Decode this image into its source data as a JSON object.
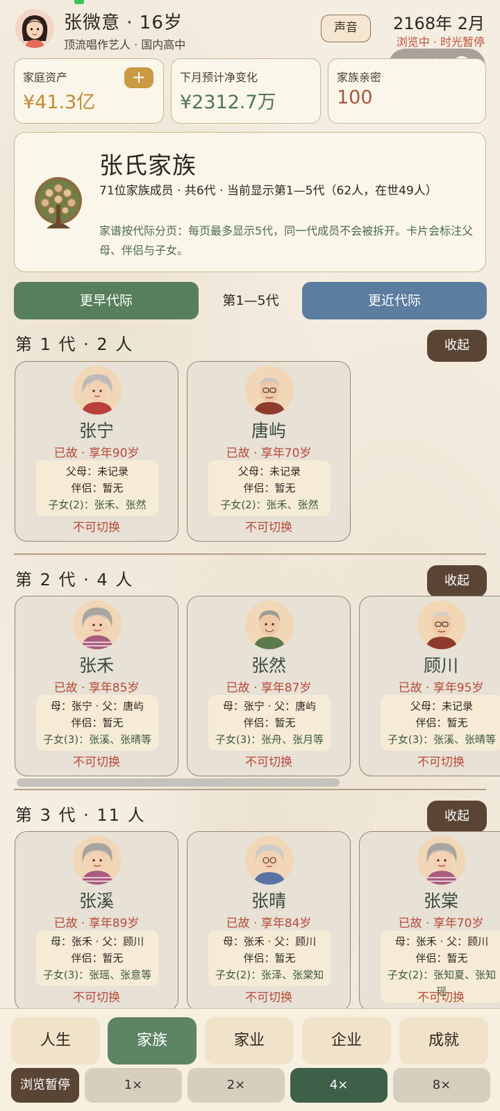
{
  "header": {
    "name_age": "张微意 · 16岁",
    "title": "顶流唱作艺人 · 国内高中",
    "sound_label": "声音",
    "date": "2168年 2月",
    "status": "浏览中 · 时光暂停",
    "capsule_dots": "•••"
  },
  "stats": [
    {
      "label": "家庭资产",
      "value": "¥41.3亿",
      "action": "+"
    },
    {
      "label": "下月预计净变化",
      "value": "¥2312.7万"
    },
    {
      "label": "家族亲密",
      "value": "100"
    }
  ],
  "family": {
    "title": "张氏家族",
    "summary": "71位家族成员 · 共6代 · 当前显示第1—5代（62人，在世49人）",
    "description": "家谱按代际分页：每页最多显示5代，同一代成员不会被拆开。卡片会标注父母、伴侣与子女。"
  },
  "nav": {
    "earlier": "更早代际",
    "range": "第1—5代",
    "later": "更近代际"
  },
  "generations": [
    {
      "title": "第 1 代 · 2 人",
      "collapse": "收起",
      "members": [
        {
          "name": "张宁",
          "status": "已故 · 享年90岁",
          "parents": "父母：未记录",
          "partner": "伴侣：暂无",
          "children": "子女(2)：张禾、张然",
          "switch": "不可切换"
        },
        {
          "name": "唐屿",
          "status": "已故 · 享年70岁",
          "parents": "父母：未记录",
          "partner": "伴侣：暂无",
          "children": "子女(2)：张禾、张然",
          "switch": "不可切换"
        }
      ]
    },
    {
      "title": "第 2 代 · 4 人",
      "collapse": "收起",
      "members": [
        {
          "name": "张禾",
          "status": "已故 · 享年85岁",
          "parents": "母：张宁 · 父：唐屿",
          "partner": "伴侣：暂无",
          "children": "子女(3)：张溪、张晴等",
          "switch": "不可切换"
        },
        {
          "name": "张然",
          "status": "已故 · 享年87岁",
          "parents": "母：张宁 · 父：唐屿",
          "partner": "伴侣：暂无",
          "children": "子女(3)：张舟、张月等",
          "switch": "不可切换"
        },
        {
          "name": "顾川",
          "status": "已故 · 享年95岁",
          "parents": "父母：未记录",
          "partner": "伴侣：暂无",
          "children": "子女(3)：张溪、张晴等",
          "switch": "不可切换"
        }
      ]
    },
    {
      "title": "第 3 代 · 11 人",
      "collapse": "收起",
      "members": [
        {
          "name": "张溪",
          "status": "已故 · 享年89岁",
          "parents": "母：张禾 · 父：顾川",
          "partner": "伴侣：暂无",
          "children": "子女(3)：张瑶、张意等",
          "switch": "不可切换"
        },
        {
          "name": "张晴",
          "status": "已故 · 享年84岁",
          "parents": "母：张禾 · 父：顾川",
          "partner": "伴侣：暂无",
          "children": "子女(2)：张泽、张棠知",
          "switch": "不可切换"
        },
        {
          "name": "张棠",
          "status": "已故 · 享年70岁",
          "parents": "母：张禾 · 父：顾川",
          "partner": "伴侣：暂无",
          "children": "子女(2)：张知夏、张知瑶",
          "switch": "不可切换"
        }
      ]
    }
  ],
  "tabs": [
    "人生",
    "家族",
    "家业",
    "企业",
    "成就"
  ],
  "active_tab": "家族",
  "speed": {
    "pause": "浏览暂停",
    "options": [
      "1×",
      "2×",
      "4×",
      "8×"
    ],
    "active": "4×"
  },
  "colors": {
    "accent_green": "#5d8463",
    "accent_blue": "#5b7d9f",
    "deceased_red": "#b84a36",
    "gold": "#c99a42"
  },
  "icons": {
    "tree": "family-tree-emblem",
    "avatar": "portrait-avatar",
    "more": "more-dots-icon",
    "target": "target-icon"
  }
}
